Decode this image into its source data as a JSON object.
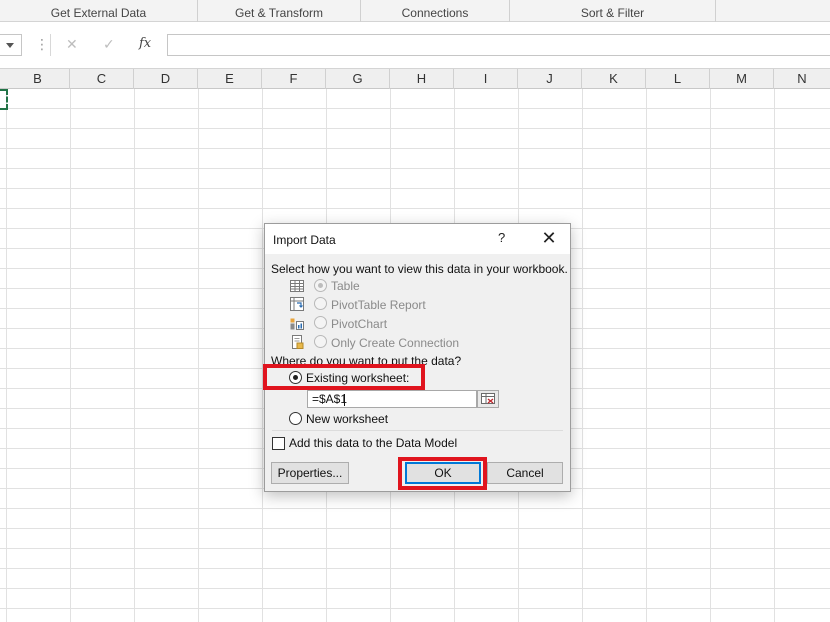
{
  "ribbon": {
    "groups": [
      "Get External Data",
      "Get & Transform",
      "Connections",
      "Sort & Filter"
    ]
  },
  "formula_bar": {
    "cancel_icon": "✕",
    "enter_icon": "✓",
    "function_icon": "fx",
    "dots": "⋮",
    "value": ""
  },
  "sheet": {
    "columns": [
      "B",
      "C",
      "D",
      "E",
      "F",
      "G",
      "H",
      "I",
      "J",
      "K",
      "L",
      "M",
      "N"
    ]
  },
  "dialog": {
    "title": "Import Data",
    "help": "?",
    "close": "✕",
    "view_prompt": "Select how you want to view this data in your workbook.",
    "view_options": [
      {
        "label": "Table",
        "icon": "table-icon",
        "selected": true,
        "enabled": false
      },
      {
        "label": "PivotTable Report",
        "icon": "pivottable-icon",
        "selected": false,
        "enabled": false
      },
      {
        "label": "PivotChart",
        "icon": "pivotchart-icon",
        "selected": false,
        "enabled": false
      },
      {
        "label": "Only Create Connection",
        "icon": "connection-icon",
        "selected": false,
        "enabled": false
      }
    ],
    "location_prompt": "Where do you want to put the data?",
    "existing_worksheet_label": "Existing worksheet:",
    "cell_reference": "=$A$1",
    "new_worksheet_label": "New worksheet",
    "data_model_label": "Add this data to the Data Model",
    "properties_button": "Properties...",
    "ok_button": "OK",
    "cancel_button": "Cancel"
  },
  "colors": {
    "highlight": "#e0141e",
    "excel_green": "#217346",
    "default_button_border": "#0078d7"
  }
}
